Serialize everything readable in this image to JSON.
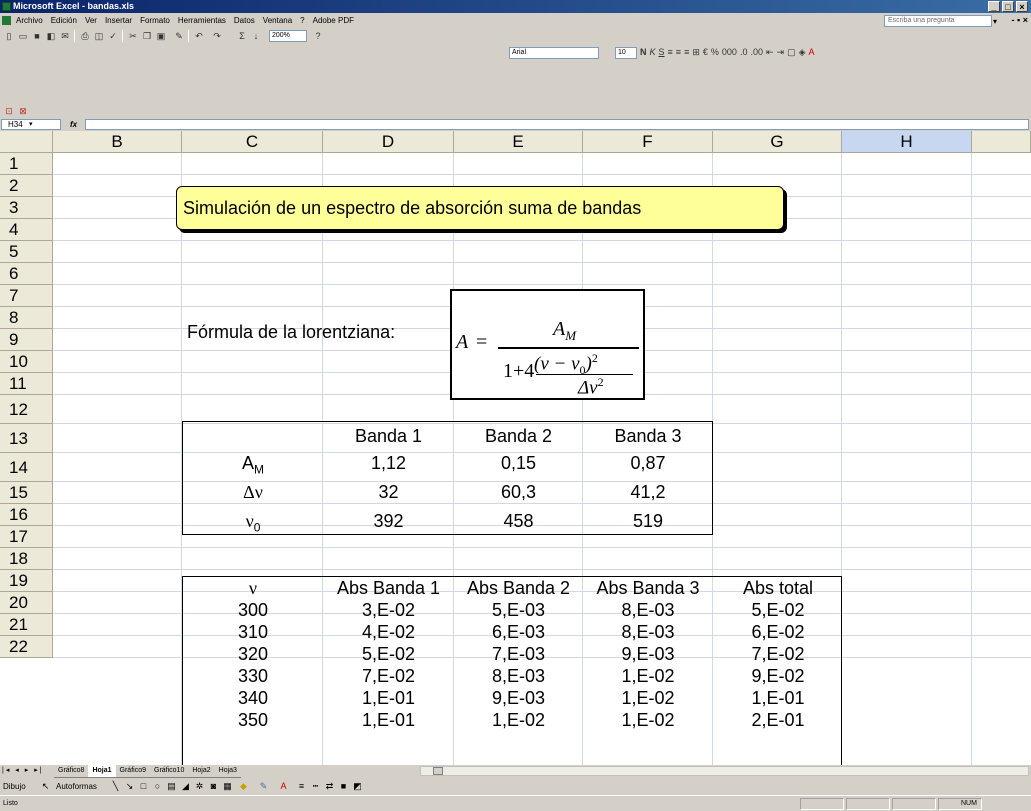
{
  "window": {
    "title": "Microsoft Excel - bandas.xls",
    "controls": [
      "_",
      "□",
      "×"
    ]
  },
  "menu": {
    "items": [
      "Archivo",
      "Edición",
      "Ver",
      "Insertar",
      "Formato",
      "Herramientas",
      "Datos",
      "Ventana",
      "?",
      "Adobe PDF"
    ],
    "help_placeholder": "Escriba una pregunta",
    "doc_controls": "- ▪ ×"
  },
  "toolbar": {
    "zoom": "200%",
    "font_name": "Arial",
    "font_size": "10"
  },
  "formula_bar": {
    "name_box": "H34",
    "fx": "fx",
    "value": ""
  },
  "columns": [
    "B",
    "C",
    "D",
    "E",
    "F",
    "G",
    "H"
  ],
  "rows": [
    "1",
    "2",
    "3",
    "4",
    "5",
    "6",
    "7",
    "8",
    "9",
    "10",
    "11",
    "12",
    "13",
    "14",
    "15",
    "16",
    "17",
    "18",
    "19",
    "20",
    "21",
    "22"
  ],
  "title_callout": "Simulación de un espectro de absorción suma de bandas",
  "formula_label": "Fórmula de la lorentziana:",
  "params_table": {
    "headers": [
      "Banda 1",
      "Banda 2",
      "Banda 3"
    ],
    "rows": [
      {
        "label": "A",
        "label_sub": "M",
        "values": [
          "1,12",
          "0,15",
          "0,87"
        ]
      },
      {
        "label": "Δν",
        "label_sub": "",
        "values": [
          "32",
          "60,3",
          "41,2"
        ]
      },
      {
        "label": "ν",
        "label_sub": "0",
        "values": [
          "392",
          "458",
          "519"
        ]
      }
    ]
  },
  "abs_table": {
    "headers": [
      "ν",
      "Abs Banda 1",
      "Abs Banda 2",
      "Abs Banda 3",
      "Abs total"
    ],
    "rows": [
      [
        "300",
        "3,E-02",
        "5,E-03",
        "8,E-03",
        "5,E-02"
      ],
      [
        "310",
        "4,E-02",
        "6,E-03",
        "8,E-03",
        "6,E-02"
      ],
      [
        "320",
        "5,E-02",
        "7,E-03",
        "9,E-03",
        "7,E-02"
      ],
      [
        "330",
        "7,E-02",
        "8,E-03",
        "1,E-02",
        "9,E-02"
      ],
      [
        "340",
        "1,E-01",
        "9,E-03",
        "1,E-02",
        "1,E-01"
      ],
      [
        "350",
        "1,E-01",
        "1,E-02",
        "1,E-02",
        "2,E-01"
      ]
    ]
  },
  "sheet_tabs": [
    "Gráfico8",
    "Hoja1",
    "Gráfico9",
    "Gráfico10",
    "Hoja2",
    "Hoja3"
  ],
  "active_tab": "Hoja1",
  "draw_toolbar": {
    "draw_label": "Dibujo",
    "autoshapes_label": "Autoformas"
  },
  "status": {
    "text": "Listo",
    "num": "NUM"
  }
}
